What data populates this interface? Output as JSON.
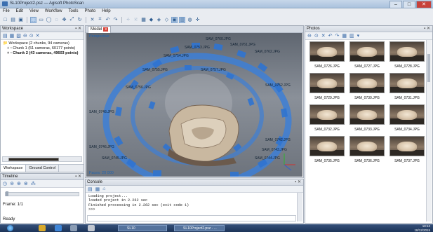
{
  "window": {
    "title": "SL10Project2.psz — Agisoft PhotoScan"
  },
  "menu": [
    "File",
    "Edit",
    "View",
    "Workflow",
    "Tools",
    "Photo",
    "Help"
  ],
  "workspace": {
    "title": "Workspace",
    "root": "Workspace (2 chunks, 94 cameras)",
    "chunk1": "Chunk 1 (51 cameras, 60177 points)",
    "chunk2": "Chunk 2 (43 cameras, 49603 points)",
    "tabs": [
      "Workspace",
      "Ground Control"
    ]
  },
  "timeline": {
    "title": "Timeline",
    "frame": "Frame: 1/1"
  },
  "model": {
    "tab_label": "Model",
    "perspective": "Perspective",
    "faces_label": "Faces: 20 000",
    "camera_labels": [
      "SAM_0760.JPG",
      "SAM_0761.JPG",
      "SAM_0762.JPG",
      "SAM_0753.JPG",
      "SAM_0754.JPG",
      "SAM_0755.JPG",
      "SAM_0756.JPG",
      "SAM_0757.JPG",
      "SAM_0752.JPG",
      "SAM_0748.JPG",
      "SAM_0746.JPG",
      "SAM_0745.JPG",
      "SAM_0742.JPG",
      "SAM_0743.JPG",
      "SAM_0744.JPG"
    ]
  },
  "console": {
    "title": "Console",
    "lines": [
      "Loading project...",
      "loaded project in 2.262 sec",
      "Finished processing in 2.262 sec (exit code 1)",
      ">>>"
    ]
  },
  "photos": {
    "title": "Photos",
    "items": [
      "SAM_0726.JPG",
      "SAM_0727.JPG",
      "SAM_0728.JPG",
      "SAM_0729.JPG",
      "SAM_0730.JPG",
      "SAM_0731.JPG",
      "SAM_0732.JPG",
      "SAM_0733.JPG",
      "SAM_0734.JPG",
      "SAM_0735.JPG",
      "SAM_0736.JPG",
      "SAM_0737.JPG"
    ]
  },
  "status": {
    "text": "Ready"
  },
  "taskbar": {
    "item1": "SL10",
    "item2": "SL10Project2.psz - ...",
    "time": "18:12",
    "date": "18/12/2015"
  }
}
